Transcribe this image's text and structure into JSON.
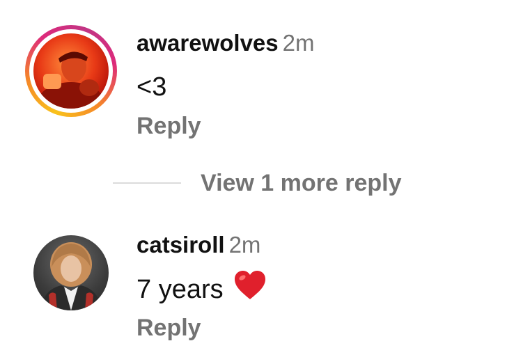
{
  "comments": [
    {
      "username": "awarewolves",
      "time": "2m",
      "text": "<3",
      "reply_label": "Reply",
      "has_story_ring": true
    },
    {
      "username": "catsiroll",
      "time": "2m",
      "text": "7 years",
      "reply_label": "Reply",
      "has_story_ring": false,
      "emoji": "red-heart"
    }
  ],
  "view_more": {
    "label": "View 1 more reply"
  },
  "colors": {
    "muted_text": "#737373",
    "divider": "#dbdbdb",
    "heart": "#e0202c"
  }
}
